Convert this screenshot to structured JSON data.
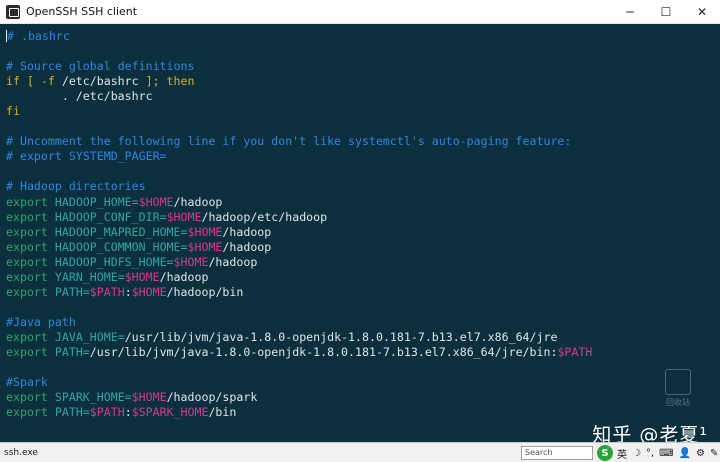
{
  "window": {
    "title": "OpenSSH SSH client",
    "minimize_glyph": "─",
    "maximize_glyph": "☐",
    "close_glyph": "✕"
  },
  "terminal": {
    "lines": [
      [
        {
          "t": "comment",
          "v": "# .bashrc"
        }
      ],
      [],
      [
        {
          "t": "comment",
          "v": "# Source global definitions"
        }
      ],
      [
        {
          "t": "keyword",
          "v": "if [ -f "
        },
        {
          "t": "plain",
          "v": "/etc/bashrc"
        },
        {
          "t": "keyword",
          "v": " ]; then"
        }
      ],
      [
        {
          "t": "plain",
          "v": "        . /etc/bashrc"
        }
      ],
      [
        {
          "t": "keyword",
          "v": "fi"
        }
      ],
      [],
      [
        {
          "t": "comment",
          "v": "# Uncomment the following line if you don't like systemctl's auto-paging feature:"
        }
      ],
      [
        {
          "t": "comment",
          "v": "# export SYSTEMD_PAGER="
        }
      ],
      [],
      [
        {
          "t": "comment",
          "v": "# Hadoop directories"
        }
      ],
      [
        {
          "t": "export",
          "v": "export "
        },
        {
          "t": "var",
          "v": "HADOOP_HOME="
        },
        {
          "t": "expand",
          "v": "$HOME"
        },
        {
          "t": "plain",
          "v": "/hadoop"
        }
      ],
      [
        {
          "t": "export",
          "v": "export "
        },
        {
          "t": "var",
          "v": "HADOOP_CONF_DIR="
        },
        {
          "t": "expand",
          "v": "$HOME"
        },
        {
          "t": "plain",
          "v": "/hadoop/etc/hadoop"
        }
      ],
      [
        {
          "t": "export",
          "v": "export "
        },
        {
          "t": "var",
          "v": "HADOOP_MAPRED_HOME="
        },
        {
          "t": "expand",
          "v": "$HOME"
        },
        {
          "t": "plain",
          "v": "/hadoop"
        }
      ],
      [
        {
          "t": "export",
          "v": "export "
        },
        {
          "t": "var",
          "v": "HADOOP_COMMON_HOME="
        },
        {
          "t": "expand",
          "v": "$HOME"
        },
        {
          "t": "plain",
          "v": "/hadoop"
        }
      ],
      [
        {
          "t": "export",
          "v": "export "
        },
        {
          "t": "var",
          "v": "HADOOP_HDFS_HOME="
        },
        {
          "t": "expand",
          "v": "$HOME"
        },
        {
          "t": "plain",
          "v": "/hadoop"
        }
      ],
      [
        {
          "t": "export",
          "v": "export "
        },
        {
          "t": "var",
          "v": "YARN_HOME="
        },
        {
          "t": "expand",
          "v": "$HOME"
        },
        {
          "t": "plain",
          "v": "/hadoop"
        }
      ],
      [
        {
          "t": "export",
          "v": "export "
        },
        {
          "t": "var",
          "v": "PATH="
        },
        {
          "t": "expand",
          "v": "$PATH"
        },
        {
          "t": "plain",
          "v": ":"
        },
        {
          "t": "expand",
          "v": "$HOME"
        },
        {
          "t": "plain",
          "v": "/hadoop/bin"
        }
      ],
      [],
      [
        {
          "t": "comment",
          "v": "#Java path"
        }
      ],
      [
        {
          "t": "export",
          "v": "export "
        },
        {
          "t": "var",
          "v": "JAVA_HOME="
        },
        {
          "t": "plain",
          "v": "/usr/lib/jvm/java-1.8.0-openjdk-1.8.0.181-7.b13.el7.x86_64/jre"
        }
      ],
      [
        {
          "t": "export",
          "v": "export "
        },
        {
          "t": "var",
          "v": "PATH="
        },
        {
          "t": "plain",
          "v": "/usr/lib/jvm/java-1.8.0-openjdk-1.8.0.181-7.b13.el7.x86_64/jre/bin:"
        },
        {
          "t": "expand",
          "v": "$PATH"
        }
      ],
      [],
      [
        {
          "t": "comment",
          "v": "#Spark"
        }
      ],
      [
        {
          "t": "export",
          "v": "export "
        },
        {
          "t": "var",
          "v": "SPARK_HOME="
        },
        {
          "t": "expand",
          "v": "$HOME"
        },
        {
          "t": "plain",
          "v": "/hadoop/spark"
        }
      ],
      [
        {
          "t": "export",
          "v": "export "
        },
        {
          "t": "var",
          "v": "PATH="
        },
        {
          "t": "expand",
          "v": "$PATH"
        },
        {
          "t": "plain",
          "v": ":"
        },
        {
          "t": "expand",
          "v": "$SPARK_HOME"
        },
        {
          "t": "plain",
          "v": "/bin"
        }
      ]
    ]
  },
  "desktop": {
    "recycle_bin_label": "回收站",
    "watermark": "知乎 @老夏¹"
  },
  "taskbar": {
    "task_label": "ssh.exe",
    "search_placeholder": "Search",
    "ime_icon_glyph": "S",
    "ime_lang": "英",
    "tray_glyphs": [
      "☽",
      "°,",
      "⌨",
      "👤",
      "⚙",
      "✎"
    ]
  },
  "colors": {
    "terminal_bg": "#0c2f3e",
    "comment": "#2f86e0",
    "keyword": "#d6b21f",
    "export": "#2fa66c",
    "variable": "#2fa5a3",
    "expansion": "#d33a8f",
    "text": "#dfe6e8"
  }
}
